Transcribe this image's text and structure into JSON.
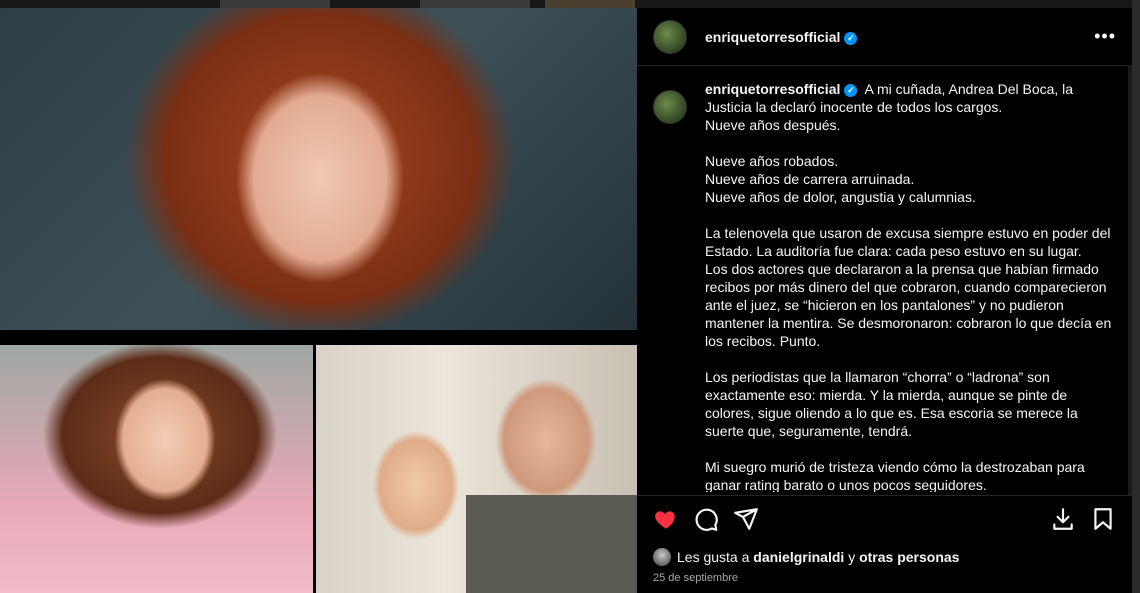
{
  "post": {
    "username": "enriquetorresofficial",
    "caption_intro": "A mi cuñada, Andrea Del Boca, la Justicia la declaró inocente de todos los cargos.\nNueve años después.",
    "paragraphs": [
      "Nueve años robados.\nNueve años de carrera arruinada.\nNueve años de dolor, angustia y calumnias.",
      "La telenovela que usaron de excusa siempre estuvo en poder del Estado. La auditoría fue clara: cada peso estuvo en su lugar.\nLos dos actores que declararon a la prensa que habían firmado recibos por más dinero del que cobraron, cuando comparecieron ante el juez, se “hicieron en los pantalones” y no pudieron mantener la mentira. Se desmoronaron: cobraron lo que decía en los recibos. Punto.",
      "Los periodistas que la llamaron “chorra” o “ladrona” son exactamente eso: mierda. Y la mierda, aunque se pinte de colores, sigue oliendo a lo que es. Esa escoria se merece la suerte que, seguramente, tendrá.",
      "Mi suegro murió de tristeza viendo cómo la destrozaban para ganar rating barato o unos pocos seguidores."
    ],
    "likes_prefix": "Les gusta a",
    "likes_user": "danielgrinaldi",
    "likes_middle": "y",
    "likes_suffix": "otras personas",
    "date": "25 de septiembre"
  },
  "icons": {
    "verified": "verified-badge-icon",
    "more": "more-options-icon",
    "like": "heart-icon",
    "comment": "comment-icon",
    "share": "send-icon",
    "download": "download-icon",
    "save": "bookmark-icon"
  },
  "colors": {
    "like_active": "#ff3040",
    "verified": "#0095f6",
    "panel_bg": "#000000",
    "text": "#f5f5f5"
  }
}
